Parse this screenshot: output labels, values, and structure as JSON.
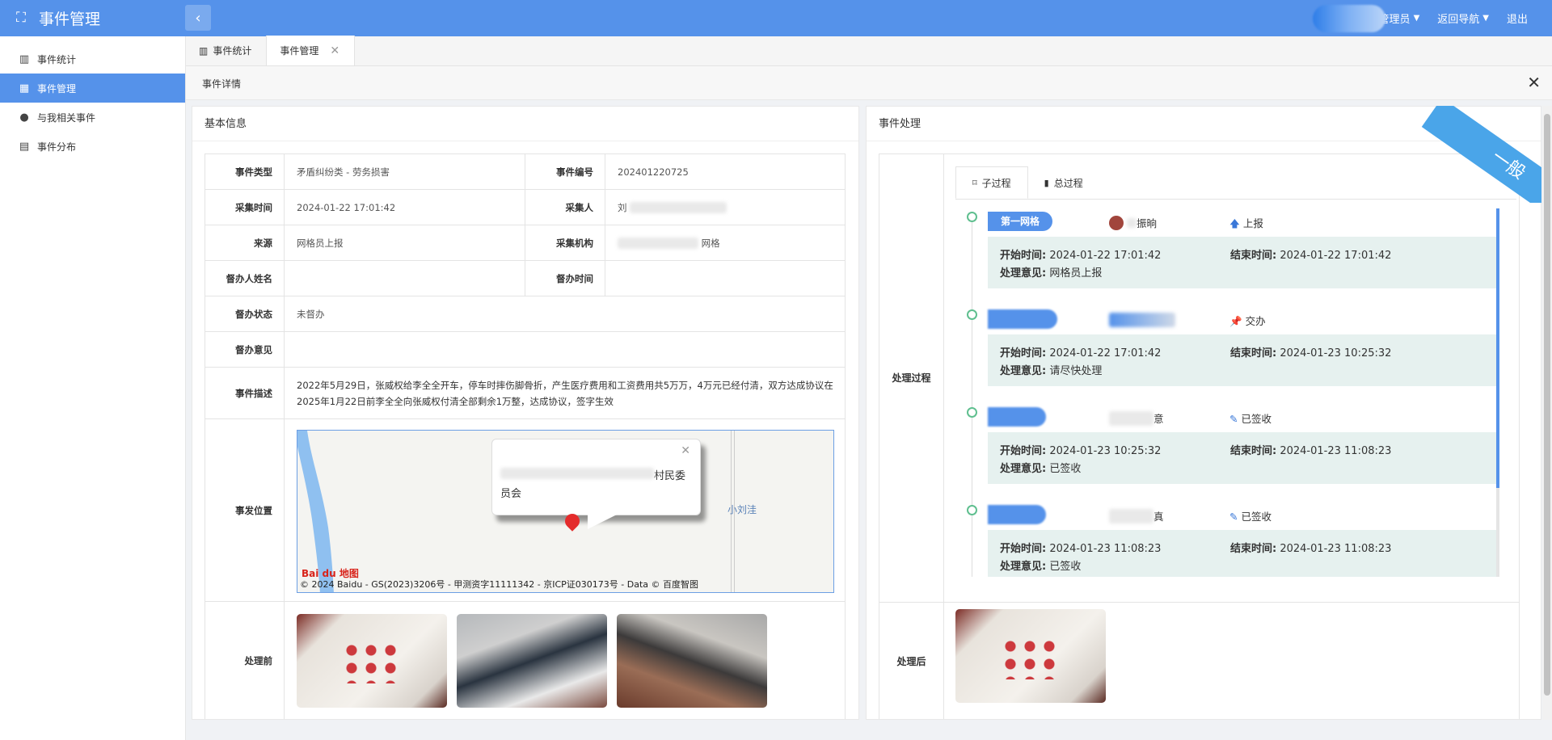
{
  "app": {
    "title": "事件管理"
  },
  "header": {
    "admin_label": "管理员",
    "nav_label": "返回导航",
    "logout_label": "退出"
  },
  "sidebar": {
    "items": [
      {
        "label": "事件统计",
        "icon": "bar-chart-icon"
      },
      {
        "label": "事件管理",
        "icon": "grid-icon",
        "active": true
      },
      {
        "label": "与我相关事件",
        "icon": "user-icon"
      },
      {
        "label": "事件分布",
        "icon": "map-icon"
      }
    ]
  },
  "tabs": [
    {
      "label": "事件统计"
    },
    {
      "label": "事件管理",
      "active": true
    }
  ],
  "page": {
    "title": "事件详情"
  },
  "basic": {
    "title": "基本信息",
    "labels": {
      "type": "事件类型",
      "code": "事件编号",
      "time": "采集时间",
      "collector": "采集人",
      "source": "来源",
      "org": "采集机构",
      "supervisor": "督办人姓名",
      "super_time": "督办时间",
      "super_state": "督办状态",
      "super_opinion": "督办意见",
      "desc": "事件描述",
      "location": "事发位置",
      "before": "处理前"
    },
    "values": {
      "type": "矛盾纠纷类 - 劳务损害",
      "code": "202401220725",
      "time": "2024-01-22 17:01:42",
      "collector_prefix": "刘",
      "source": "网格员上报",
      "org_suffix": "网格",
      "super_state": "未督办",
      "desc": "2022年5月29日，张威权给李全全开车，停车时摔伤脚骨折，产生医疗费用和工资费用共5万万，4万元已经付清，双方达成协议在2025年1月22日前李全全向张威权付清全部剩余1万整，达成协议，签字生效"
    },
    "map": {
      "popup_text_1": "村民委",
      "popup_text_2": "员会",
      "place": "小刘洼",
      "logo": "Bai du 地图",
      "copyright": "© 2024 Baidu - GS(2023)3206号 - 甲测资字11111342 - 京ICP证030173号 - Data © 百度智图"
    }
  },
  "process": {
    "title": "事件处理",
    "ribbon": "一般",
    "process_label": "处理过程",
    "after_label": "处理后",
    "tabs": [
      {
        "label": "子过程",
        "active": true
      },
      {
        "label": "总过程"
      }
    ],
    "labels": {
      "start": "开始时间:",
      "end": "结束时间:",
      "opinion": "处理意见:"
    },
    "steps": [
      {
        "node": "第一网格",
        "person": "振晌",
        "action": "上报",
        "action_icon": "arrow-up-icon",
        "start": "2024-01-22 17:01:42",
        "end": "2024-01-22 17:01:42",
        "opinion": "网格员上报"
      },
      {
        "node": "",
        "person": "",
        "action": "交办",
        "action_icon": "pin-icon",
        "start": "2024-01-22 17:01:42",
        "end": "2024-01-23 10:25:32",
        "opinion": "请尽快处理"
      },
      {
        "node": "",
        "person": "意",
        "action": "已签收",
        "action_icon": "pencil-icon",
        "start": "2024-01-23 10:25:32",
        "end": "2024-01-23 11:08:23",
        "opinion": "已签收"
      },
      {
        "node": "",
        "person": "真",
        "action": "已签收",
        "action_icon": "pencil-icon",
        "start": "2024-01-23 11:08:23",
        "end": "2024-01-23 11:08:23",
        "opinion": "已签收"
      }
    ]
  }
}
